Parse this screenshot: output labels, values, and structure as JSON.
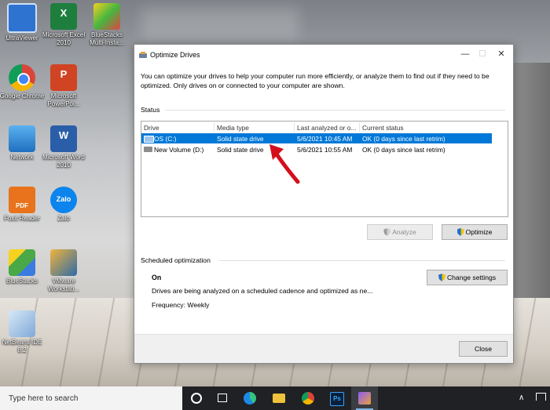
{
  "desktop_icons": [
    {
      "label": "UltraViewer",
      "icon": "ultraviewer-icon",
      "color": "#2f73d1",
      "glyph": ""
    },
    {
      "label": "Microsoft Excel 2010",
      "icon": "excel-icon",
      "color": "#1e7e3e",
      "glyph": "X"
    },
    {
      "label": "BlueStacks Multi-Insta...",
      "icon": "bluestacks-multi-icon",
      "color": "#46b640",
      "glyph": ""
    },
    {
      "label": "Google Chrome",
      "icon": "chrome-icon",
      "color": "#db4437",
      "glyph": ""
    },
    {
      "label": "Microsoft PowerPoi...",
      "icon": "powerpoint-icon",
      "color": "#d04423",
      "glyph": "P"
    },
    {
      "label": "Network",
      "icon": "network-icon",
      "color": "#2f86d6",
      "glyph": ""
    },
    {
      "label": "Microsoft Word 2010",
      "icon": "word-icon",
      "color": "#2b5ea8",
      "glyph": "W"
    },
    {
      "label": "Foxit Reader",
      "icon": "foxit-reader-icon",
      "color": "#e8731c",
      "glyph": "PDF"
    },
    {
      "label": "Zalo",
      "icon": "zalo-icon",
      "color": "#0b84ee",
      "glyph": "Zalo"
    },
    {
      "label": "BlueStacks",
      "icon": "bluestacks-icon",
      "color": "#4aa846",
      "glyph": ""
    },
    {
      "label": "VMware Workstati...",
      "icon": "vmware-icon",
      "color": "#2d6aa8",
      "glyph": ""
    },
    {
      "label": "NetBeans IDE 8.2",
      "icon": "netbeans-icon",
      "color": "#7fa8d8",
      "glyph": ""
    }
  ],
  "window": {
    "title": "Optimize Drives",
    "description": "You can optimize your drives to help your computer run more efficiently, or analyze them to find out if they need to be optimized. Only drives on or connected to your computer are shown.",
    "status_label": "Status",
    "columns": [
      "Drive",
      "Media type",
      "Last analyzed or o...",
      "Current status"
    ],
    "drives": [
      {
        "drive": "OS (C:)",
        "media": "Solid state drive",
        "last": "5/6/2021 10:45 AM",
        "status": "OK (0 days since last retrim)"
      },
      {
        "drive": "New Volume (D:)",
        "media": "Solid state drive",
        "last": "5/6/2021 10:55 AM",
        "status": "OK (0 days since last retrim)"
      }
    ],
    "analyze_label": "Analyze",
    "optimize_label": "Optimize",
    "scheduled_label": "Scheduled optimization",
    "schedule_status": "On",
    "schedule_desc": "Drives are being analyzed on a scheduled cadence and optimized as ne...",
    "frequency": "Frequency: Weekly",
    "change_settings_label": "Change settings",
    "close_label": "Close"
  },
  "taskbar": {
    "search_placeholder": "Type here to search",
    "tray_chevron": "∧"
  },
  "colors": {
    "selection": "#0078d7",
    "annotation_arrow": "#d40f1b"
  }
}
